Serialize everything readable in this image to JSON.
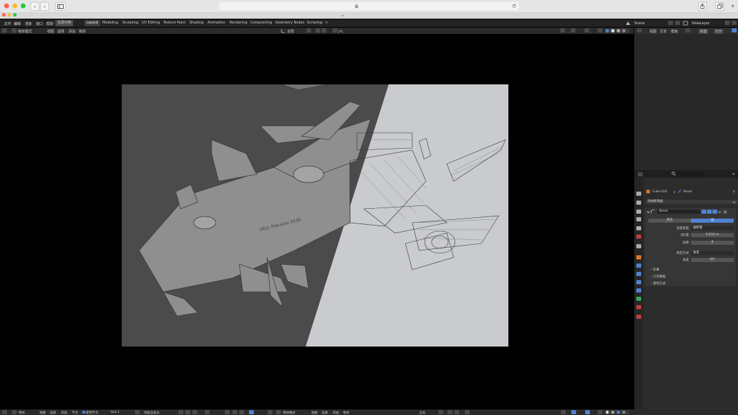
{
  "window": {
    "traffic_lights": [
      "#ff5f57",
      "#febc2e",
      "#28c840"
    ],
    "nav_back": "‹",
    "nav_forward": "›",
    "lock_symbol": "🔒",
    "add_tab": "+"
  },
  "menu": {
    "items": [
      "文件",
      "编辑",
      "渲染",
      "窗口",
      "帮助"
    ],
    "toggle_label": "全屏切换",
    "workspaces": [
      "Layout",
      "Modeling",
      "Sculpting",
      "UV Editing",
      "Texture Paint",
      "Shading",
      "Animation",
      "Rendering",
      "Compositing",
      "Geometry Nodes",
      "Scripting"
    ],
    "add_workspace": "+",
    "scene_label": "Scene",
    "viewlayer_label": "ViewLayer"
  },
  "viewport_header": {
    "mode": "物体模式",
    "menus": [
      "视图",
      "选择",
      "添加",
      "物体"
    ],
    "transform": "全局"
  },
  "outliner_header": {
    "menus": [
      "视图",
      "文本",
      "模板"
    ],
    "new_label": "新建",
    "open_label": "打开"
  },
  "properties": {
    "object_name": "Cube.024",
    "modifier_breadcrumb": "Bevel",
    "add_modifier_label": "添加修改器",
    "modifier_name": "Bevel",
    "affect_vertices": "顶点",
    "affect_edges": "边",
    "rows": [
      {
        "label": "宽度类型",
        "value": "偏移量"
      },
      {
        "label": "(宽)量",
        "value": "0.012 m"
      },
      {
        "label": "段数",
        "value": "6"
      },
      {
        "label": "限定方式",
        "value": "角度"
      },
      {
        "label": "角度",
        "value": "30°"
      }
    ],
    "subpanels": [
      "轮廓",
      "几何数据",
      "着色方式"
    ]
  },
  "bottom_bar": {
    "left_menus": [
      "物体",
      "视图",
      "选择",
      "添加",
      "节点"
    ],
    "use_nodes": "使用节点",
    "slot": "Slot 1",
    "material": "地板自发光",
    "mode2": "物体模式",
    "menus2": [
      "视图",
      "选择",
      "添加",
      "物体"
    ],
    "transform2": "全局"
  },
  "render_text": "DELL Precision 5530"
}
